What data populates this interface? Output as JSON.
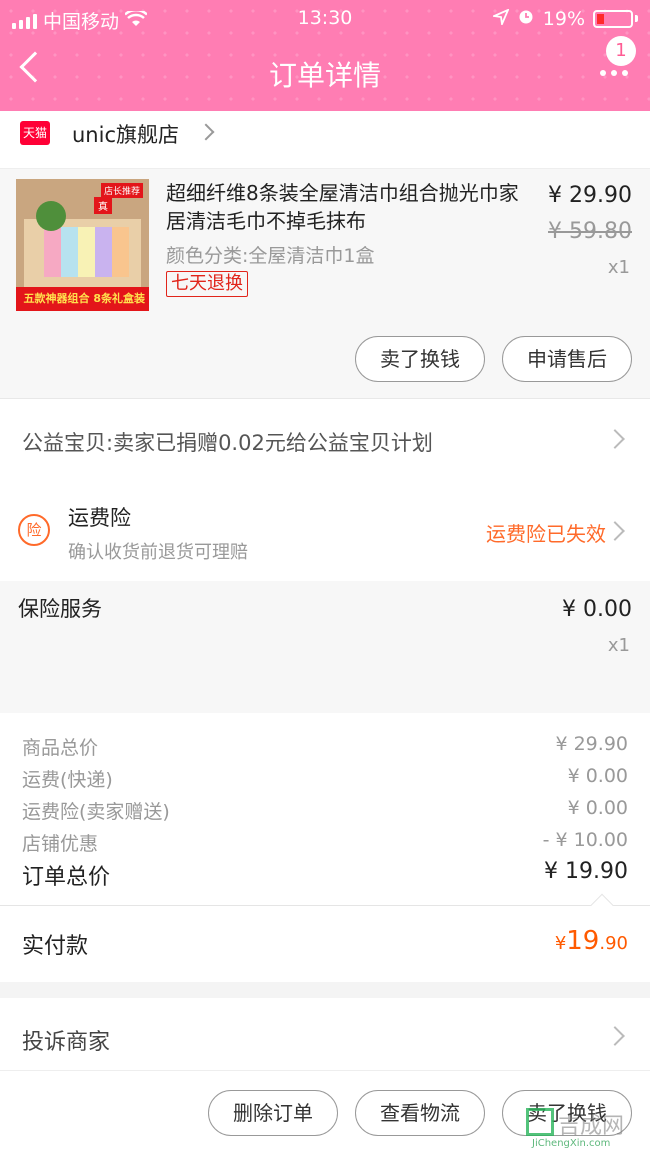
{
  "status": {
    "carrier": "中国移动",
    "time": "13:30",
    "battery": "19%"
  },
  "header": {
    "title": "订单详情",
    "badge": "1"
  },
  "shop": {
    "badge": "天猫",
    "name": "unic旗舰店"
  },
  "product": {
    "name": "超细纤维8条装全屋清洁巾组合抛光巾家居清洁毛巾不掉毛抹布",
    "sku": "颜色分类:全屋清洁巾1盒",
    "return_badge": "七天退换",
    "price": "¥ 29.90",
    "original_price": "¥ 59.80",
    "qty": "x1",
    "thumb_band": "五款神器组合 8条礼盒装",
    "thumb_tag": "店长推荐",
    "thumb_zhen": "真",
    "btn_sell": "卖了换钱",
    "btn_aftersale": "申请售后"
  },
  "charity": {
    "text": "公益宝贝:卖家已捐赠0.02元给公益宝贝计划"
  },
  "insurance": {
    "icon": "险",
    "title": "运费险",
    "subtitle": "确认收货前退货可理赔",
    "status": "运费险已失效"
  },
  "service": {
    "title": "保险服务",
    "price": "¥ 0.00",
    "qty": "x1"
  },
  "totals": {
    "rows": [
      {
        "label": "商品总价",
        "value": "¥ 29.90"
      },
      {
        "label": "运费(快递)",
        "value": "¥ 0.00"
      },
      {
        "label": "运费险(卖家赠送)",
        "value": "¥ 0.00"
      },
      {
        "label": "店铺优惠",
        "value": "- ¥ 10.00"
      }
    ],
    "order_total_label": "订单总价",
    "order_total_value": "¥ 19.90"
  },
  "paid": {
    "label": "实付款",
    "currency": "¥",
    "int": "19",
    "dec": ".90"
  },
  "complain": {
    "label": "投诉商家"
  },
  "actions": {
    "delete": "删除订单",
    "logistics": "查看物流",
    "sell": "卖了换钱"
  },
  "watermark": {
    "text": "吉成网",
    "url": "JiChengXin.com"
  },
  "colors": {
    "header": "#ff7db3",
    "accent": "#ff6a2a",
    "price_orange": "#ff5a00",
    "tmall_red": "#ff0036"
  }
}
